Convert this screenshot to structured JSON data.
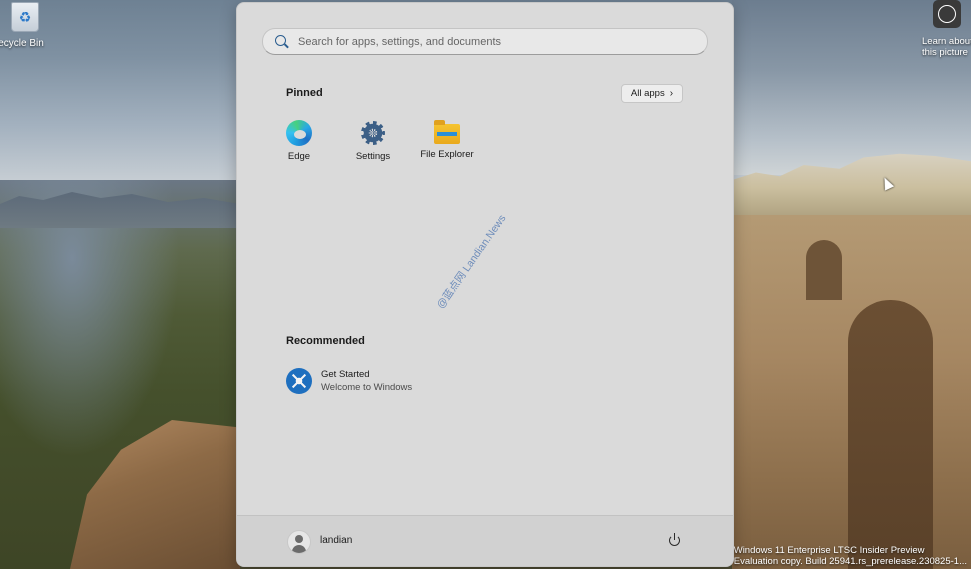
{
  "desktop": {
    "recycle_bin_label": "ecycle Bin",
    "learn_picture_line1": "Learn about",
    "learn_picture_line2": "this picture",
    "build_line1": "Windows 11 Enterprise LTSC Insider Preview",
    "build_line2": "Evaluation copy. Build 25941.rs_prerelease.230825-1..."
  },
  "start_menu": {
    "search": {
      "placeholder": "Search for apps, settings, and documents"
    },
    "pinned": {
      "title": "Pinned",
      "all_apps_label": "All apps",
      "all_apps_chevron": "›",
      "apps": [
        {
          "label": "Edge",
          "icon": "edge-icon"
        },
        {
          "label": "Settings",
          "icon": "settings-gear-icon"
        },
        {
          "label": "File Explorer",
          "icon": "folder-icon"
        }
      ]
    },
    "watermark": "@蓝点网 Landian.News",
    "recommended": {
      "title": "Recommended",
      "items": [
        {
          "title": "Get Started",
          "subtitle": "Welcome to Windows",
          "icon": "get-started-icon"
        }
      ]
    },
    "footer": {
      "user_name": "landian",
      "power_icon": "power-icon"
    }
  }
}
